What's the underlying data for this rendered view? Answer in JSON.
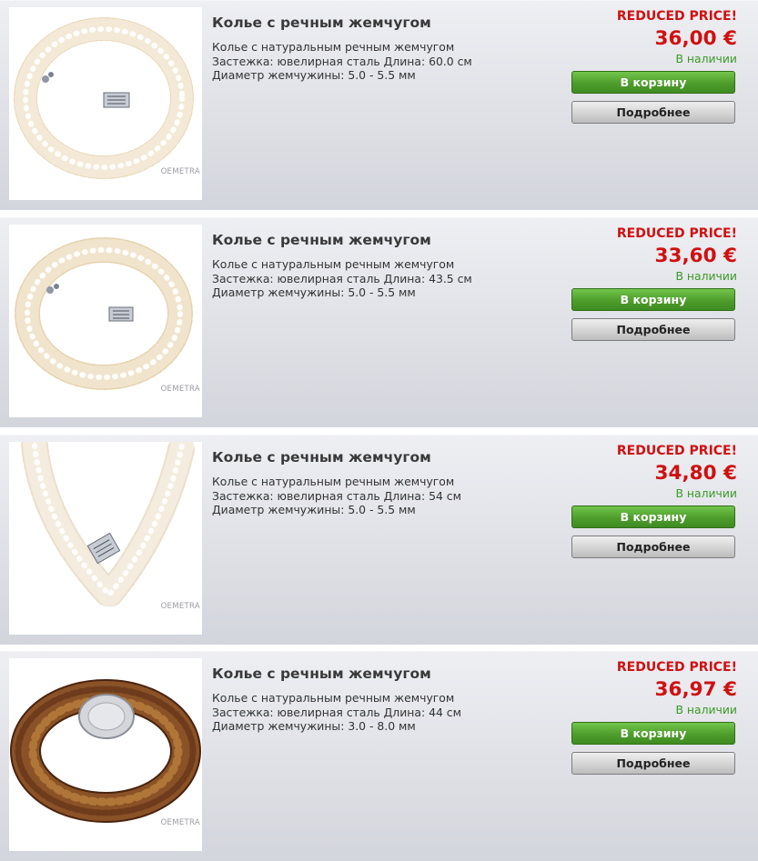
{
  "products": [
    {
      "title": "Колье с речным жемчугом",
      "desc_lines": [
        "Колье с натуральным речным жемчугом",
        "Застежка: ювелирная сталь Длина: 60.0 см",
        "Диаметр жемчужины: 5.0 - 5.5 мм"
      ],
      "badge": "REDUCED PRICE!",
      "price": "36,00 €",
      "stock": "В наличии",
      "cart_label": "В корзину",
      "details_label": "Подробнее",
      "watermark": "OEMETRA"
    },
    {
      "title": "Колье с речным жемчугом",
      "desc_lines": [
        "Колье с натуральным речным жемчугом",
        "Застежка: ювелирная сталь Длина: 43.5 см",
        "Диаметр жемчужины: 5.0 - 5.5 мм"
      ],
      "badge": "REDUCED PRICE!",
      "price": "33,60 €",
      "stock": "В наличии",
      "cart_label": "В корзину",
      "details_label": "Подробнее",
      "watermark": "OEMETRA"
    },
    {
      "title": "Колье с речным жемчугом",
      "desc_lines": [
        "Колье с натуральным речным жемчугом",
        "Застежка: ювелирная сталь Длина: 54 см",
        "Диаметр жемчужины: 5.0 - 5.5 мм"
      ],
      "badge": "REDUCED PRICE!",
      "price": "34,80 €",
      "stock": "В наличии",
      "cart_label": "В корзину",
      "details_label": "Подробнее",
      "watermark": "OEMETRA"
    },
    {
      "title": "Колье с речным жемчугом",
      "desc_lines": [
        "Колье с натуральным речным жемчугом",
        "Застежка: ювелирная сталь Длина: 44 см",
        "Диаметр жемчужины: 3.0 - 8.0 мм"
      ],
      "badge": "REDUCED PRICE!",
      "price": "36,97 €",
      "stock": "В наличии",
      "cart_label": "В корзину",
      "details_label": "Подробнее",
      "watermark": "OEMETRA"
    }
  ],
  "colors": {
    "accent_red": "#d01010",
    "in_stock_green": "#3a9a26",
    "cart_button_green": "#4e9d2c",
    "pearl_white": "#f3ead8",
    "pearl_brown": "#6e3c1c"
  },
  "icons": {
    "product_image": "pearl-necklace-photo"
  }
}
